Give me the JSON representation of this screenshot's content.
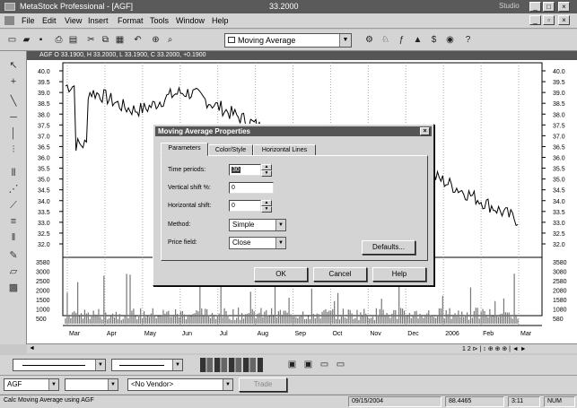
{
  "app": {
    "title": "MetaStock Professional - [AGF]",
    "center_title": "33.2000",
    "right_label": "Studio"
  },
  "menu": [
    "File",
    "Edit",
    "View",
    "Insert",
    "Format",
    "Tools",
    "Window",
    "Help"
  ],
  "toolbar": {
    "indicator_combo": "Moving Average"
  },
  "chart": {
    "header": "AGF  O 33.1900, H 33.2000, L 33.1900, C 33.2000, +0.1900",
    "price_ticks": [
      "40.0",
      "39.5",
      "39.0",
      "38.5",
      "38.0",
      "37.5",
      "37.0",
      "36.5",
      "36.0",
      "35.5",
      "35.0",
      "34.5",
      "34.0",
      "33.5",
      "33.0",
      "32.5",
      "32.0"
    ],
    "volume_ticks": [
      "3580",
      "3080",
      "2580",
      "2080",
      "1580",
      "1080",
      "580"
    ],
    "volume_ticks_left": [
      "3580",
      "3000",
      "2500",
      "2000",
      "1500",
      "1000",
      "500"
    ],
    "months": [
      "Mar",
      "Apr",
      "May",
      "Jun",
      "Jul",
      "Aug",
      "Sep",
      "Oct",
      "Nov",
      "Dec",
      "2006",
      "Feb",
      "Mar"
    ]
  },
  "dialog": {
    "title": "Moving Average Properties",
    "tabs": [
      "Parameters",
      "Color/Style",
      "Horizontal Lines"
    ],
    "fields": {
      "time_periods_label": "Time periods:",
      "time_periods_value": "30",
      "vertical_shift_label": "Vertical shift %:",
      "vertical_shift_value": "0",
      "horizontal_shift_label": "Horizontal shift:",
      "horizontal_shift_value": "0",
      "method_label": "Method:",
      "method_value": "Simple",
      "price_field_label": "Price field:",
      "price_field_value": "Close"
    },
    "defaults_button": "Defaults...",
    "ok_button": "OK",
    "cancel_button": "Cancel",
    "help_button": "Help"
  },
  "bottom": {
    "symbol": "AGF",
    "vendor": "<No Vendor>",
    "trade_button": "Trade"
  },
  "status": {
    "message": "Calc Moving Average using AGF",
    "date": "09/15/2004",
    "value": "88.4465",
    "time": "3:11",
    "num": "NUM"
  }
}
